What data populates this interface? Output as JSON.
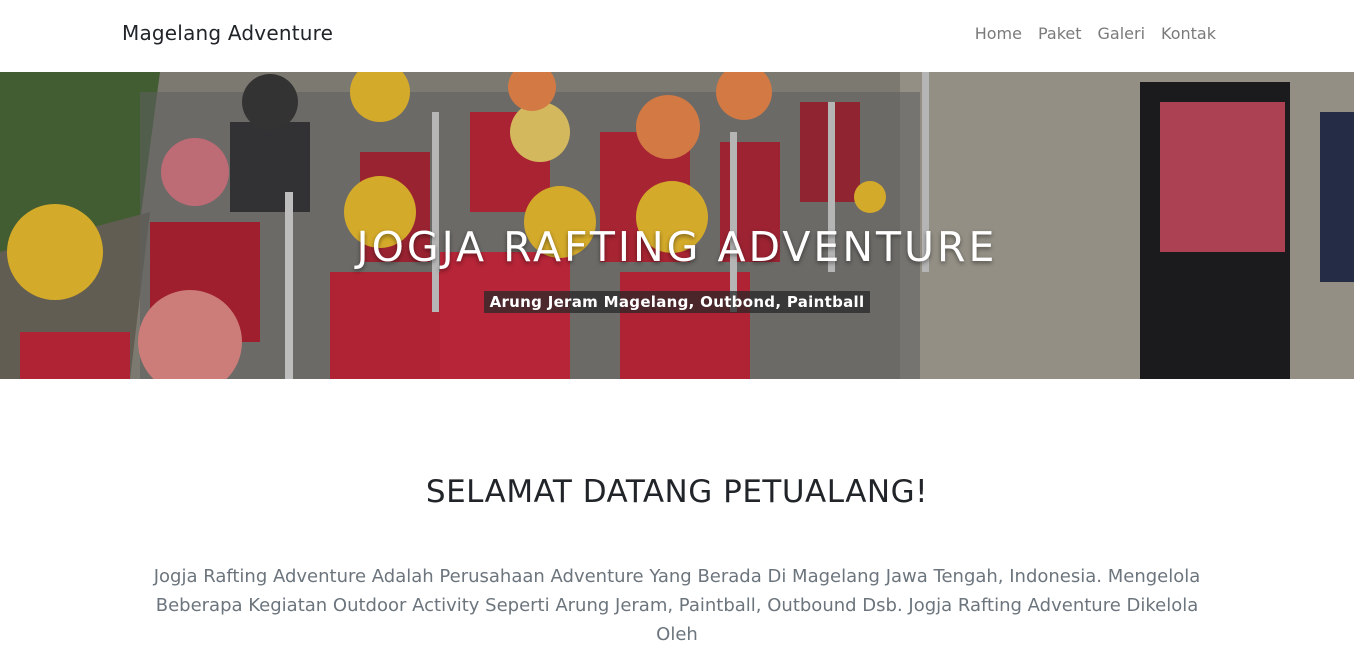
{
  "navbar": {
    "brand": "Magelang Adventure",
    "links": [
      "Home",
      "Paket",
      "Galeri",
      "Kontak"
    ]
  },
  "hero": {
    "title": "JOGJA RAFTING ADVENTURE",
    "subtitle": "Arung Jeram Magelang, Outbond, Paintball",
    "image_description": "hero-photo"
  },
  "main": {
    "heading": "SELAMAT DATANG PETUALANG!",
    "intro": "Jogja Rafting Adventure Adalah Perusahaan Adventure Yang Berada Di Magelang Jawa Tengah, Indonesia. Mengelola Beberapa Kegiatan Outdoor Activity Seperti Arung Jeram, Paintball, Outbound Dsb. Jogja Rafting Adventure Dikelola Oleh"
  },
  "colors": {
    "helmet_yellow": "#f2c230",
    "helmet_orange": "#ef8a4e",
    "vest_red": "#c8283c",
    "ground": "#9a968c"
  }
}
